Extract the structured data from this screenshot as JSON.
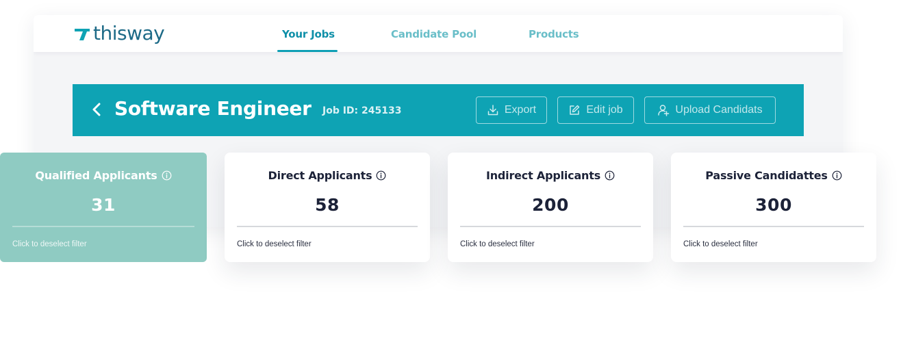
{
  "brand": {
    "name": "thisway",
    "logo_icon": "thisway-mark-icon",
    "color": "#1d6a87"
  },
  "nav": {
    "tabs": [
      {
        "label": "Your Jobs",
        "active": true
      },
      {
        "label": "Candidate Pool",
        "active": false
      },
      {
        "label": "Products",
        "active": false
      }
    ]
  },
  "job": {
    "title": "Software Engineer",
    "id_label": "Job ID: 245133",
    "actions": {
      "export": {
        "label": "Export",
        "icon": "download-icon"
      },
      "edit": {
        "label": "Edit job",
        "icon": "edit-icon"
      },
      "upload": {
        "label": "Upload Candidats",
        "icon": "add-user-icon"
      }
    }
  },
  "stats": [
    {
      "title": "Qualified Applicants",
      "value": "31",
      "hint": "Click to deselect filter",
      "selected": true
    },
    {
      "title": "Direct Applicants",
      "value": "58",
      "hint": "Click to deselect filter",
      "selected": false
    },
    {
      "title": "Indirect Applicants",
      "value": "200",
      "hint": "Click to deselect filter",
      "selected": false
    },
    {
      "title": "Passive Candidattes",
      "value": "300",
      "hint": "Click to deselect filter",
      "selected": false
    }
  ],
  "colors": {
    "accent": "#0ea3b4",
    "selected_card": "#8fcbc2",
    "nav_active": "#0e8fa8",
    "nav_inactive": "#69bec8",
    "text_dark": "#1c2238"
  }
}
